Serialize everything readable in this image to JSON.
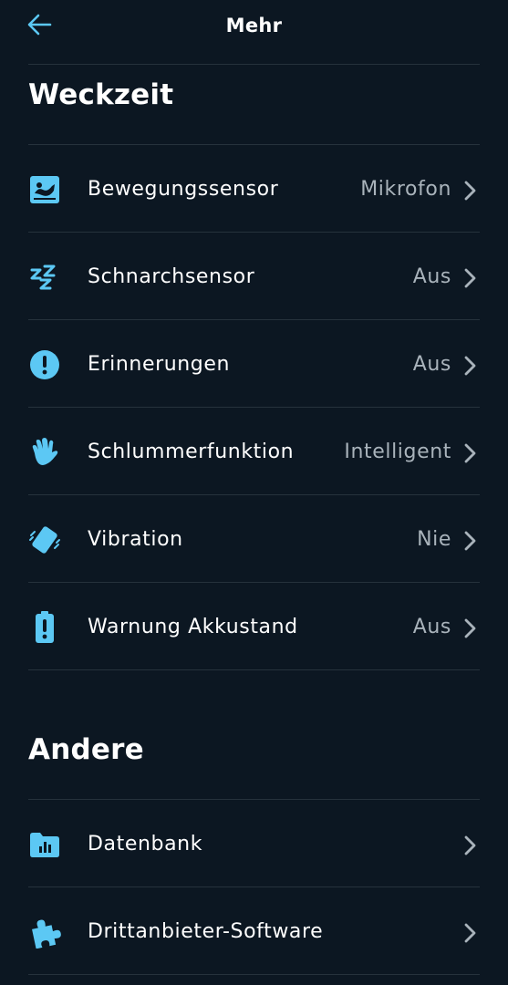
{
  "header": {
    "title": "Mehr",
    "back_icon": "arrow-left-icon"
  },
  "colors": {
    "background": "#0c1722",
    "accent": "#5cc8f4",
    "text": "#ffffff",
    "secondary_text": "#a9b3bb",
    "divider": "#26323c"
  },
  "sections": [
    {
      "title": "Weckzeit",
      "items": [
        {
          "label": "Bewegungssensor",
          "value": "Mikrofon",
          "icon": "motion-sensor-icon"
        },
        {
          "label": "Schnarchsensor",
          "value": "Aus",
          "icon": "snore-zz-icon"
        },
        {
          "label": "Erinnerungen",
          "value": "Aus",
          "icon": "exclamation-circle-icon"
        },
        {
          "label": "Schlummerfunktion",
          "value": "Intelligent",
          "icon": "hand-wave-icon"
        },
        {
          "label": "Vibration",
          "value": "Nie",
          "icon": "vibrating-phone-icon"
        },
        {
          "label": "Warnung Akkustand",
          "value": "Aus",
          "icon": "battery-alert-icon"
        }
      ]
    },
    {
      "title": "Andere",
      "items": [
        {
          "label": "Datenbank",
          "value": "",
          "icon": "folder-chart-icon"
        },
        {
          "label": "Drittanbieter-Software",
          "value": "",
          "icon": "puzzle-piece-icon"
        }
      ]
    }
  ]
}
